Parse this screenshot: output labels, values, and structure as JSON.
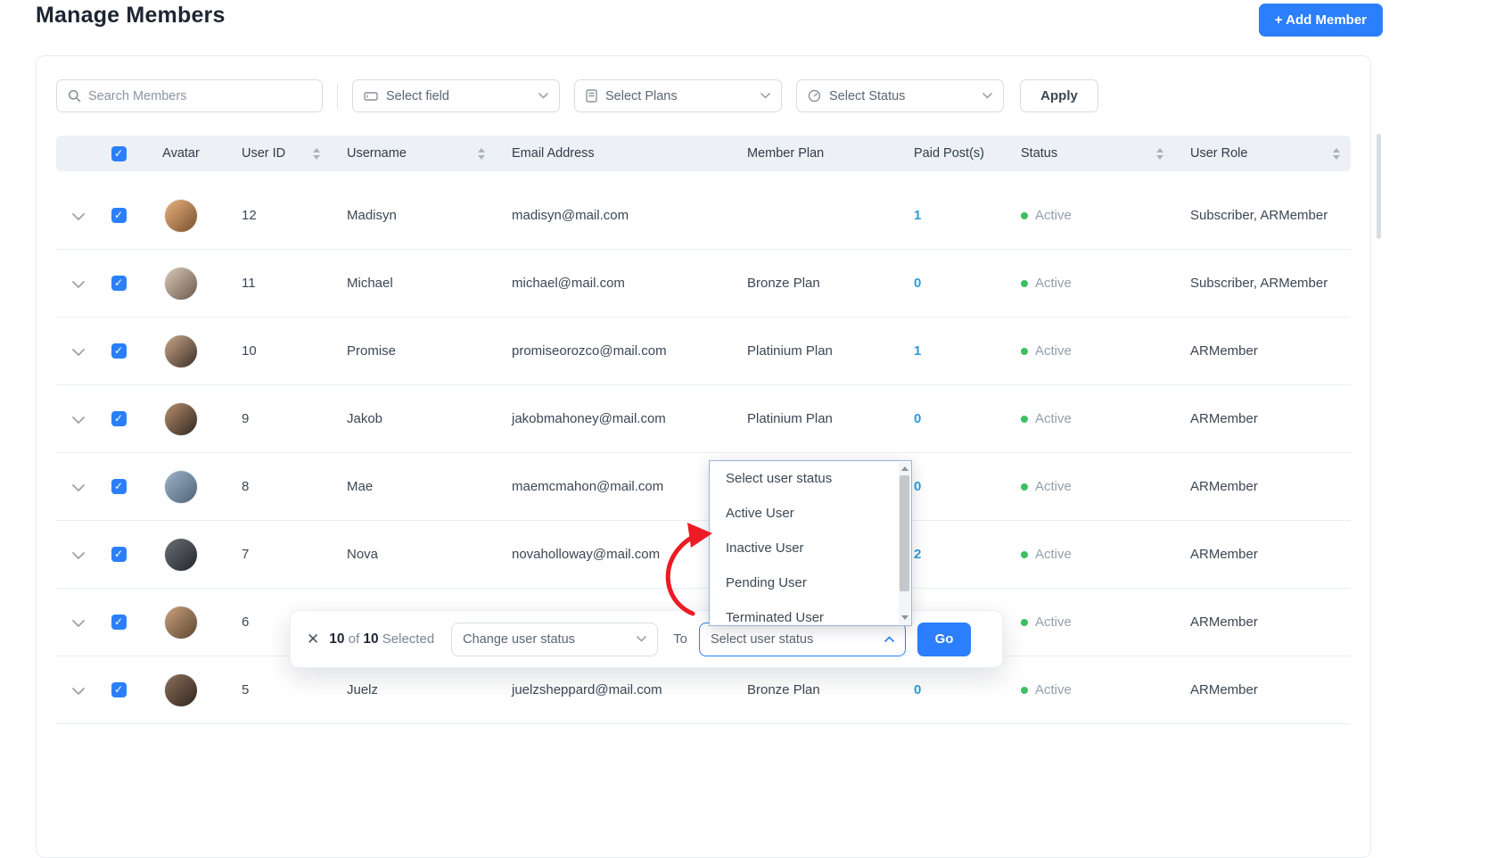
{
  "page": {
    "title": "Manage Members"
  },
  "header": {
    "add_member_label": "+ Add Member"
  },
  "filters": {
    "search_placeholder": "Search Members",
    "select_field": "Select field",
    "select_plans": "Select Plans",
    "select_status": "Select Status",
    "apply_label": "Apply"
  },
  "table": {
    "columns": [
      "Avatar",
      "User ID",
      "Username",
      "Email Address",
      "Member Plan",
      "Paid Post(s)",
      "Status",
      "User Role"
    ],
    "rows": [
      {
        "user_id": "12",
        "username": "Madisyn",
        "email": "madisyn@mail.com",
        "plan": "",
        "paid_posts": "1",
        "status": "Active",
        "role": "Subscriber, ARMember"
      },
      {
        "user_id": "11",
        "username": "Michael",
        "email": "michael@mail.com",
        "plan": "Bronze Plan",
        "paid_posts": "0",
        "status": "Active",
        "role": "Subscriber, ARMember"
      },
      {
        "user_id": "10",
        "username": "Promise",
        "email": "promiseorozco@mail.com",
        "plan": "Platinium Plan",
        "paid_posts": "1",
        "status": "Active",
        "role": "ARMember"
      },
      {
        "user_id": "9",
        "username": "Jakob",
        "email": "jakobmahoney@mail.com",
        "plan": "Platinium Plan",
        "paid_posts": "0",
        "status": "Active",
        "role": "ARMember"
      },
      {
        "user_id": "8",
        "username": "Mae",
        "email": "maemcmahon@mail.com",
        "plan": "",
        "paid_posts": "0",
        "status": "Active",
        "role": "ARMember"
      },
      {
        "user_id": "7",
        "username": "Nova",
        "email": "novaholloway@mail.com",
        "plan": "",
        "paid_posts": "2",
        "status": "Active",
        "role": "ARMember"
      },
      {
        "user_id": "6",
        "username": "",
        "email": "",
        "plan": "",
        "paid_posts": "",
        "status": "Active",
        "role": "ARMember"
      },
      {
        "user_id": "5",
        "username": "Juelz",
        "email": "juelzsheppard@mail.com",
        "plan": "Bronze Plan",
        "paid_posts": "0",
        "status": "Active",
        "role": "ARMember"
      }
    ]
  },
  "bulk_bar": {
    "selected": "10",
    "of_label": "of",
    "total": "10",
    "selected_label": "Selected",
    "action_select": "Change user status",
    "to_label": "To",
    "status_select": "Select user status",
    "go_label": "Go"
  },
  "status_dropdown": {
    "options": [
      "Select user status",
      "Active User",
      "Inactive User",
      "Pending User",
      "Terminated User"
    ]
  },
  "colors": {
    "accent": "#2b7ffc",
    "link": "#2d9cdb",
    "active-green": "#3dbf61",
    "arrow-red": "#ec1c24"
  }
}
